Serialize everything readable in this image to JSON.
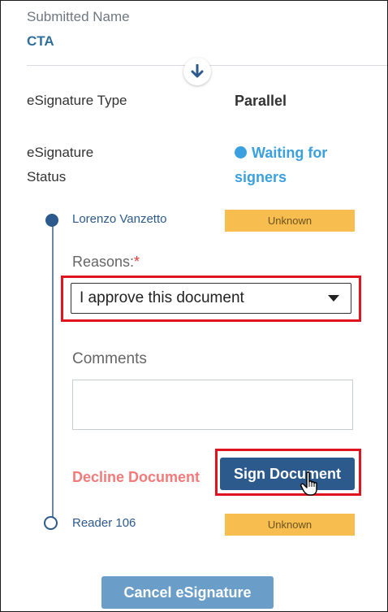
{
  "header": {
    "submitted_name_label": "Submitted Name",
    "submitted_name_value": "CTA"
  },
  "details": {
    "type_label": "eSignature Type",
    "type_value": "Parallel",
    "status_label": "eSignature Status",
    "status_value": "Waiting for signers",
    "status_color": "#3aa0e0"
  },
  "signers": [
    {
      "name": "Lorenzo Vanzetto",
      "status": "Unknown",
      "node": "filled"
    },
    {
      "name": "Reader 106",
      "status": "Unknown",
      "node": "hollow"
    }
  ],
  "form": {
    "reasons_label": "Reasons:",
    "required_mark": "*",
    "reason_selected": "I approve this document",
    "comments_label": "Comments",
    "comments_value": ""
  },
  "actions": {
    "decline_label": "Decline Document",
    "sign_label": "Sign Document",
    "cancel_label": "Cancel eSignature"
  },
  "colors": {
    "accent": "#2d5a8c",
    "badge": "#f7bd4f",
    "decline": "#f47a7a",
    "highlight": "#e0141e"
  },
  "icons": {
    "expand": "arrow-down-icon",
    "dropdown": "caret-down-icon",
    "cursor": "hand-pointer-icon"
  }
}
